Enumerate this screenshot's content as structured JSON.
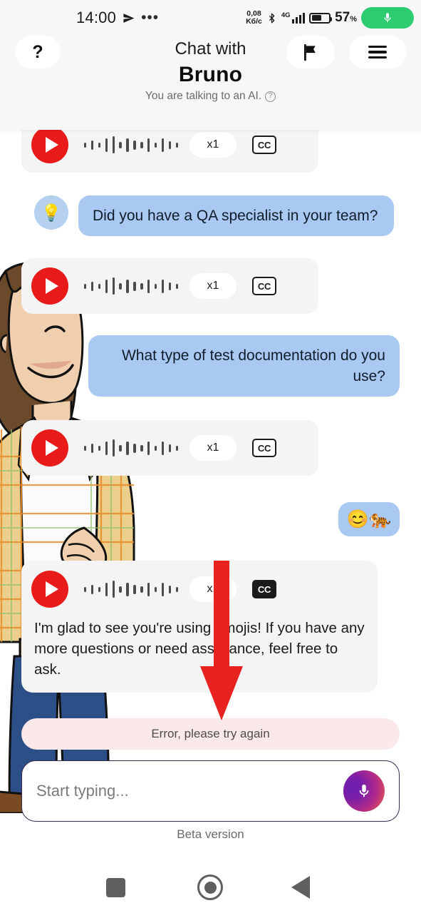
{
  "statusbar": {
    "time": "14:00",
    "send_icon": "telegram-send-icon",
    "dots": "•••",
    "data_rate_value": "0,08",
    "data_rate_unit": "Kб/c",
    "bluetooth_icon": "bluetooth-icon",
    "network_type": "4G",
    "signal_bars": 4,
    "battery_percent": "57",
    "battery_percent_symbol": "%",
    "battery_level": 57,
    "mic_pill_icon": "microphone-icon",
    "mic_pill_color": "#2ecc71"
  },
  "header": {
    "help_label": "?",
    "flag_icon": "flag-icon",
    "menu_icon": "hamburger-menu-icon",
    "title_line1": "Chat with",
    "title_line2": "Bruno",
    "subtitle": "You are talking to an AI.",
    "subtitle_info_icon": "question-circle-icon"
  },
  "chat": {
    "audio": {
      "play_icon": "play-icon",
      "play_color": "#e81a1a",
      "speed_label": "x1",
      "cc_label": "CC",
      "waveform": [
        7,
        13,
        7,
        19,
        24,
        9,
        19,
        13,
        9,
        19,
        7,
        19,
        11,
        7
      ]
    },
    "messages": [
      {
        "type": "audio",
        "speed_label": "x1",
        "cc_label": "CC",
        "cc_active": false
      },
      {
        "type": "bubble-hint",
        "avatar_icon": "lightbulb-icon",
        "avatar_emoji": "💡",
        "text": "Did you have a QA specialist in your team?"
      },
      {
        "type": "audio",
        "speed_label": "x1",
        "cc_label": "CC",
        "cc_active": false
      },
      {
        "type": "bubble-user",
        "text": "What type of test documentation do you use?"
      },
      {
        "type": "audio",
        "speed_label": "x1",
        "cc_label": "CC",
        "cc_active": false
      },
      {
        "type": "bubble-user-emoji",
        "text": "😊🐅"
      },
      {
        "type": "audio-transcript",
        "speed_label": "x1",
        "cc_label": "CC",
        "cc_active": true,
        "transcript": "I'm glad to see you're using emojis! If you have any more questions or need assistance, feel free to ask."
      }
    ]
  },
  "error": {
    "text": "Error, please try again",
    "background": "#fbe9e9"
  },
  "composer": {
    "placeholder": "Start typing...",
    "value": "",
    "mic_icon": "microphone-icon"
  },
  "footer": {
    "beta_label": "Beta version"
  },
  "annotation": {
    "arrow_icon": "down-arrow-annotation",
    "color": "#e8231f"
  },
  "navbar": {
    "recents_icon": "square-recents-icon",
    "home_icon": "circle-home-icon",
    "back_icon": "triangle-back-icon"
  }
}
